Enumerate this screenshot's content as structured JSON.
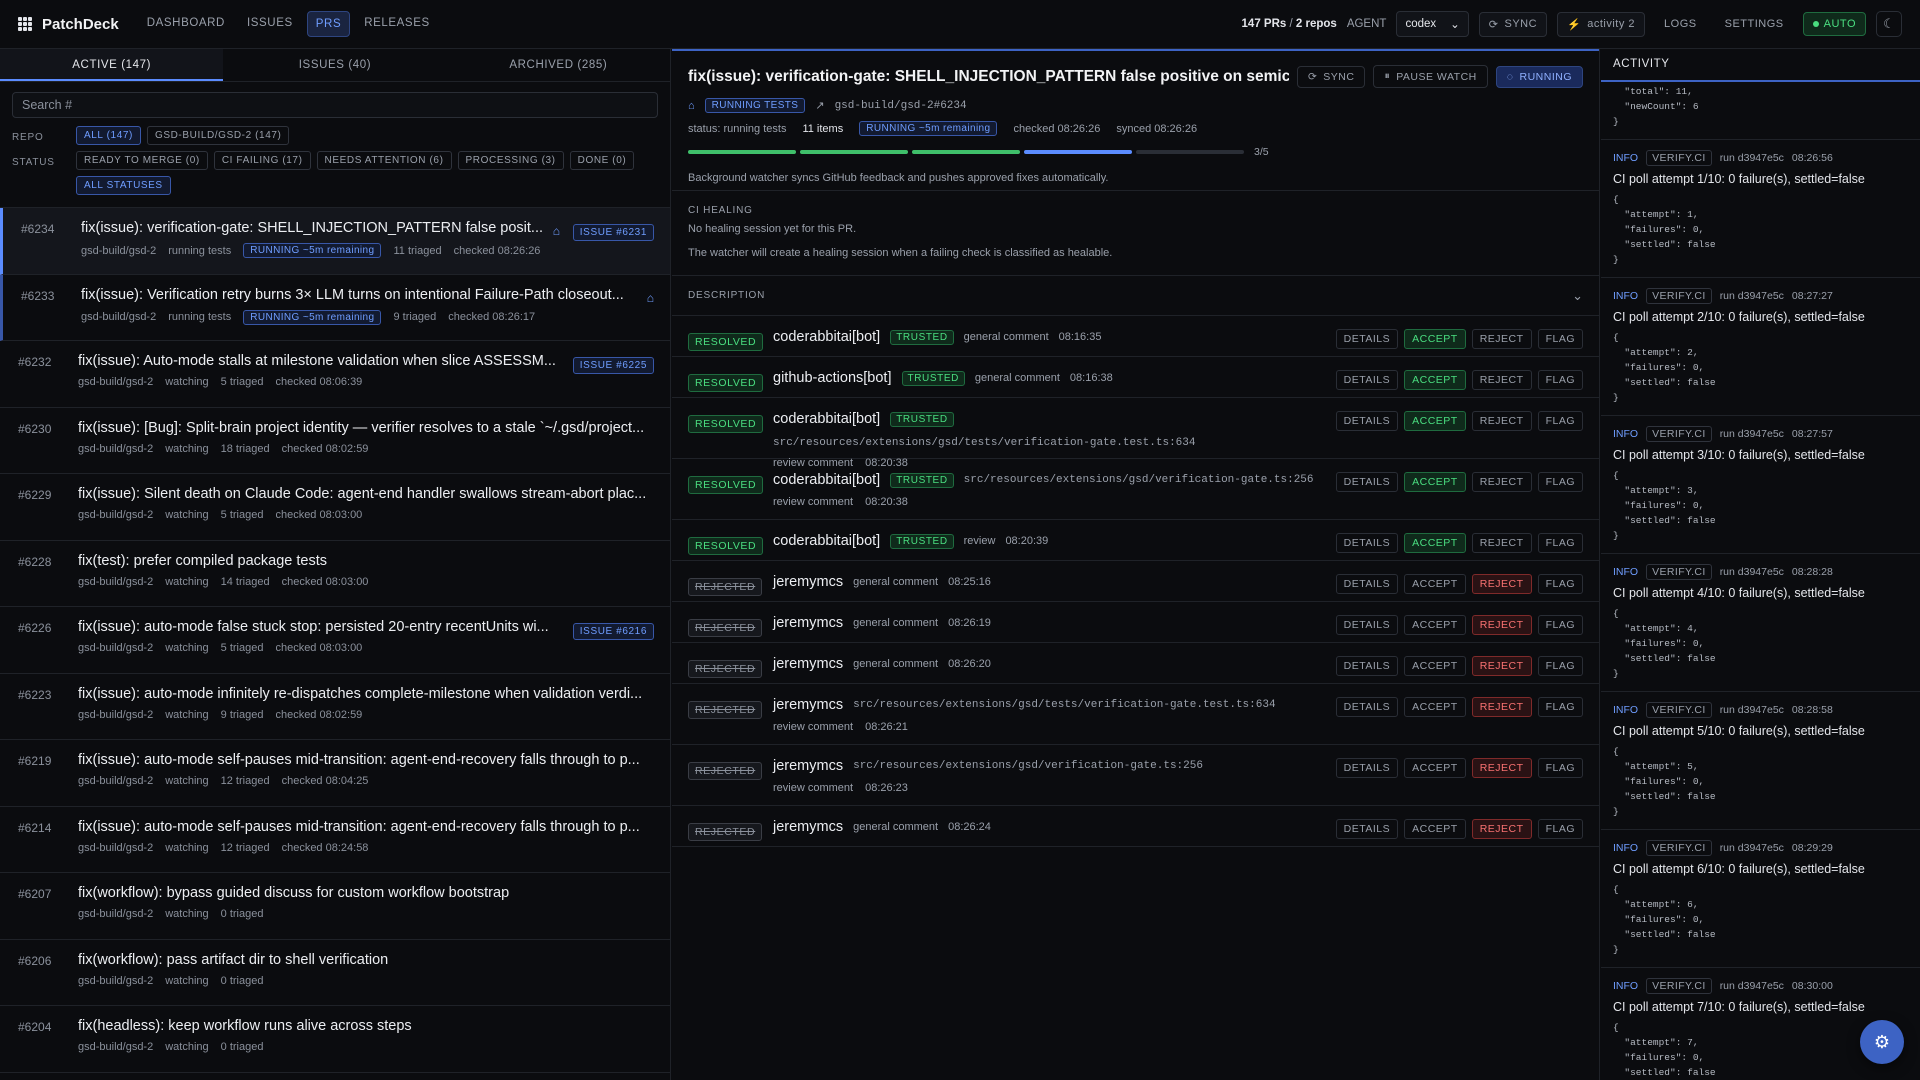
{
  "app": {
    "name": "PatchDeck"
  },
  "nav": {
    "items": [
      "DASHBOARD",
      "ISSUES",
      "PRS",
      "RELEASES"
    ],
    "active": "PRS"
  },
  "topbar": {
    "pr_count": "147 PRs",
    "repo_count": "2 repos",
    "agent_label": "AGENT",
    "agent_value": "codex",
    "sync_label": "SYNC",
    "activity_label": "activity 2",
    "logs_label": "LOGS",
    "settings_label": "SETTINGS",
    "auto_label": "AUTO"
  },
  "left": {
    "tabs": [
      "ACTIVE (147)",
      "ISSUES (40)",
      "ARCHIVED (285)"
    ],
    "search_placeholder": "Search #",
    "repo_label": "REPO",
    "repo_chips": [
      "ALL (147)",
      "GSD-BUILD/GSD-2 (147)"
    ],
    "status_label": "STATUS",
    "status_chips": [
      "READY TO MERGE (0)",
      "CI FAILING (17)",
      "NEEDS ATTENTION (6)",
      "PROCESSING (3)",
      "DONE (0)",
      "ALL STATUSES"
    ],
    "prs": [
      {
        "num": "#6234",
        "title": "fix(issue): verification-gate: SHELL_INJECTION_PATTERN false posit...",
        "repo": "gsd-build/gsd-2",
        "state": "running tests",
        "running": "RUNNING ~5m remaining",
        "triaged": "11 triaged",
        "checked": "checked 08:26:26",
        "badge": "ISSUE #6231"
      },
      {
        "num": "#6233",
        "title": "fix(issue): Verification retry burns 3× LLM turns on intentional Failure-Path closeout...",
        "repo": "gsd-build/gsd-2",
        "state": "running tests",
        "running": "RUNNING ~5m remaining",
        "triaged": "9 triaged",
        "checked": "checked 08:26:17",
        "badge": ""
      },
      {
        "num": "#6232",
        "title": "fix(issue): Auto-mode stalls at milestone validation when slice ASSESSM...",
        "repo": "gsd-build/gsd-2",
        "state": "watching",
        "running": "",
        "triaged": "5 triaged",
        "checked": "checked 08:06:39",
        "badge": "ISSUE #6225"
      },
      {
        "num": "#6230",
        "title": "fix(issue): [Bug]: Split-brain project identity — verifier resolves to a stale `~/.gsd/project...",
        "repo": "gsd-build/gsd-2",
        "state": "watching",
        "running": "",
        "triaged": "18 triaged",
        "checked": "checked 08:02:59",
        "badge": ""
      },
      {
        "num": "#6229",
        "title": "fix(issue): Silent death on Claude Code: agent-end handler swallows stream-abort plac...",
        "repo": "gsd-build/gsd-2",
        "state": "watching",
        "running": "",
        "triaged": "5 triaged",
        "checked": "checked 08:03:00",
        "badge": ""
      },
      {
        "num": "#6228",
        "title": "fix(test): prefer compiled package tests",
        "repo": "gsd-build/gsd-2",
        "state": "watching",
        "running": "",
        "triaged": "14 triaged",
        "checked": "checked 08:03:00",
        "badge": ""
      },
      {
        "num": "#6226",
        "title": "fix(issue): auto-mode false stuck stop: persisted 20-entry recentUnits wi...",
        "repo": "gsd-build/gsd-2",
        "state": "watching",
        "running": "",
        "triaged": "5 triaged",
        "checked": "checked 08:03:00",
        "badge": "ISSUE #6216"
      },
      {
        "num": "#6223",
        "title": "fix(issue): auto-mode infinitely re-dispatches complete-milestone when validation verdi...",
        "repo": "gsd-build/gsd-2",
        "state": "watching",
        "running": "",
        "triaged": "9 triaged",
        "checked": "checked 08:02:59",
        "badge": ""
      },
      {
        "num": "#6219",
        "title": "fix(issue): auto-mode self-pauses mid-transition: agent-end-recovery falls through to p...",
        "repo": "gsd-build/gsd-2",
        "state": "watching",
        "running": "",
        "triaged": "12 triaged",
        "checked": "checked 08:04:25",
        "badge": ""
      },
      {
        "num": "#6214",
        "title": "fix(issue): auto-mode self-pauses mid-transition: agent-end-recovery falls through to p...",
        "repo": "gsd-build/gsd-2",
        "state": "watching",
        "running": "",
        "triaged": "12 triaged",
        "checked": "checked 08:24:58",
        "badge": ""
      },
      {
        "num": "#6207",
        "title": "fix(workflow): bypass guided discuss for custom workflow bootstrap",
        "repo": "gsd-build/gsd-2",
        "state": "watching",
        "running": "",
        "triaged": "0 triaged",
        "checked": "",
        "badge": ""
      },
      {
        "num": "#6206",
        "title": "fix(workflow): pass artifact dir to shell verification",
        "repo": "gsd-build/gsd-2",
        "state": "watching",
        "running": "",
        "triaged": "0 triaged",
        "checked": "",
        "badge": ""
      },
      {
        "num": "#6204",
        "title": "fix(headless): keep workflow runs alive across steps",
        "repo": "gsd-build/gsd-2",
        "state": "watching",
        "running": "",
        "triaged": "0 triaged",
        "checked": "",
        "badge": ""
      }
    ]
  },
  "detail": {
    "title": "fix(issue): verification-gate: SHELL_INJECTION_PATTERN false positive on semicol...",
    "sync_label": "SYNC",
    "pause_label": "PAUSE WATCH",
    "running_label": "RUNNING",
    "tests_badge": "RUNNING TESTS",
    "ref": "gsd-build/gsd-2#6234",
    "status": "status: running tests",
    "items": "11 items",
    "running_pill": "RUNNING ~5m remaining",
    "checked": "checked 08:26:26",
    "synced": "synced 08:26:26",
    "progress_text": "3/5",
    "progress_done": 3,
    "progress_total": 5,
    "note": "Background watcher syncs GitHub feedback and pushes approved fixes automatically.",
    "ci_heading": "CI HEALING",
    "ci_line1": "No healing session yet for this PR.",
    "ci_line2": "The watcher will create a healing session when a failing check is classified as healable.",
    "desc_heading": "DESCRIPTION",
    "actions": [
      "DETAILS",
      "ACCEPT",
      "REJECT",
      "FLAG"
    ],
    "comments": [
      {
        "status": "RESOLVED",
        "author": "coderabbitai[bot]",
        "trusted": "TRUSTED",
        "path": "",
        "kind": "general comment",
        "time": "08:16:35",
        "wrap": false
      },
      {
        "status": "RESOLVED",
        "author": "github-actions[bot]",
        "trusted": "TRUSTED",
        "path": "",
        "kind": "general comment",
        "time": "08:16:38",
        "wrap": false
      },
      {
        "status": "RESOLVED",
        "author": "coderabbitai[bot]",
        "trusted": "TRUSTED",
        "path": "src/resources/extensions/gsd/tests/verification-gate.test.ts:634",
        "kind": "review comment",
        "time": "08:20:38",
        "wrap": true
      },
      {
        "status": "RESOLVED",
        "author": "coderabbitai[bot]",
        "trusted": "TRUSTED",
        "path": "src/resources/extensions/gsd/verification-gate.ts:256",
        "kind": "review comment",
        "time": "08:20:38",
        "wrap": true
      },
      {
        "status": "RESOLVED",
        "author": "coderabbitai[bot]",
        "trusted": "TRUSTED",
        "path": "",
        "kind": "review",
        "time": "08:20:39",
        "wrap": false
      },
      {
        "status": "REJECTED",
        "author": "jeremymcs",
        "trusted": "",
        "path": "",
        "kind": "general comment",
        "time": "08:25:16",
        "wrap": false
      },
      {
        "status": "REJECTED",
        "author": "jeremymcs",
        "trusted": "",
        "path": "",
        "kind": "general comment",
        "time": "08:26:19",
        "wrap": false
      },
      {
        "status": "REJECTED",
        "author": "jeremymcs",
        "trusted": "",
        "path": "",
        "kind": "general comment",
        "time": "08:26:20",
        "wrap": false
      },
      {
        "status": "REJECTED",
        "author": "jeremymcs",
        "trusted": "",
        "path": "src/resources/extensions/gsd/tests/verification-gate.test.ts:634",
        "kind": "review comment",
        "time": "08:26:21",
        "wrap": true
      },
      {
        "status": "REJECTED",
        "author": "jeremymcs",
        "trusted": "",
        "path": "src/resources/extensions/gsd/verification-gate.ts:256",
        "kind": "review comment",
        "time": "08:26:23",
        "wrap": true
      },
      {
        "status": "REJECTED",
        "author": "jeremymcs",
        "trusted": "",
        "path": "",
        "kind": "general comment",
        "time": "08:26:24",
        "wrap": false
      }
    ]
  },
  "activity": {
    "heading": "ACTIVITY",
    "top_snippet": "  \"total\": 11,\n  \"newCount\": 6\n}",
    "entries": [
      {
        "level": "INFO",
        "source": "VERIFY.CI",
        "run": "run d3947e5c",
        "time": "08:26:56",
        "message": "CI poll attempt 1/10: 0 failure(s), settled=false",
        "json": "{\n  \"attempt\": 1,\n  \"failures\": 0,\n  \"settled\": false\n}"
      },
      {
        "level": "INFO",
        "source": "VERIFY.CI",
        "run": "run d3947e5c",
        "time": "08:27:27",
        "message": "CI poll attempt 2/10: 0 failure(s), settled=false",
        "json": "{\n  \"attempt\": 2,\n  \"failures\": 0,\n  \"settled\": false\n}"
      },
      {
        "level": "INFO",
        "source": "VERIFY.CI",
        "run": "run d3947e5c",
        "time": "08:27:57",
        "message": "CI poll attempt 3/10: 0 failure(s), settled=false",
        "json": "{\n  \"attempt\": 3,\n  \"failures\": 0,\n  \"settled\": false\n}"
      },
      {
        "level": "INFO",
        "source": "VERIFY.CI",
        "run": "run d3947e5c",
        "time": "08:28:28",
        "message": "CI poll attempt 4/10: 0 failure(s), settled=false",
        "json": "{\n  \"attempt\": 4,\n  \"failures\": 0,\n  \"settled\": false\n}"
      },
      {
        "level": "INFO",
        "source": "VERIFY.CI",
        "run": "run d3947e5c",
        "time": "08:28:58",
        "message": "CI poll attempt 5/10: 0 failure(s), settled=false",
        "json": "{\n  \"attempt\": 5,\n  \"failures\": 0,\n  \"settled\": false\n}"
      },
      {
        "level": "INFO",
        "source": "VERIFY.CI",
        "run": "run d3947e5c",
        "time": "08:29:29",
        "message": "CI poll attempt 6/10: 0 failure(s), settled=false",
        "json": "{\n  \"attempt\": 6,\n  \"failures\": 0,\n  \"settled\": false\n}"
      },
      {
        "level": "INFO",
        "source": "VERIFY.CI",
        "run": "run d3947e5c",
        "time": "08:30:00",
        "message": "CI poll attempt 7/10: 0 failure(s), settled=false",
        "json": "{\n  \"attempt\": 7,\n  \"failures\": 0,\n  \"settled\": false\n}"
      }
    ]
  }
}
